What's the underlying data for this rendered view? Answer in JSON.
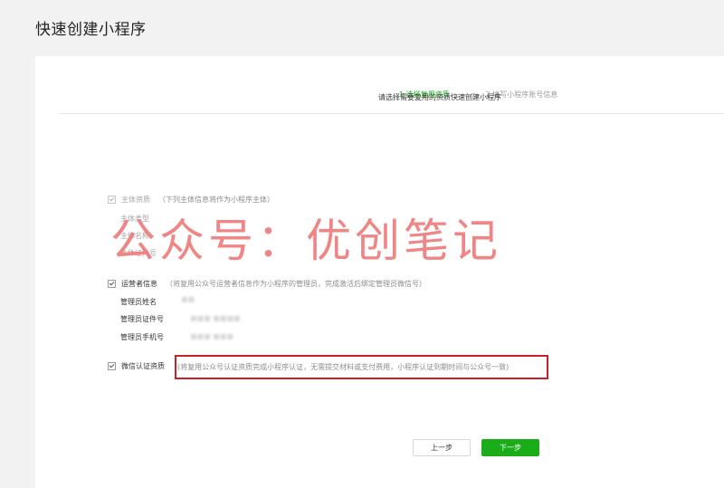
{
  "page": {
    "title": "快速创建小程序"
  },
  "steps": [
    {
      "label": "1 选择复用资质",
      "active": true
    },
    {
      "label": "2 填写小程序账号信息",
      "active": false
    }
  ],
  "intro": "请选择需要复用的资质快速创建小程序",
  "sections": {
    "entity": {
      "title": "主体资质",
      "note": "（下列主体信息将作为小程序主体）",
      "checked": true,
      "disabled": true,
      "fields": [
        "主体类型",
        "主体名称",
        "主体证件号"
      ]
    },
    "operator": {
      "title": "运营者信息",
      "note": "（将复用公众号运营者信息作为小程序的管理员，完成激活后绑定管理员微信号）",
      "checked": true,
      "disabled": false,
      "fields": [
        "管理员姓名",
        "管理员证件号",
        "管理员手机号"
      ],
      "values": [
        "■■",
        "■■■ ■■■■",
        "■■■ ■■■"
      ]
    },
    "certification": {
      "title": "微信认证资质",
      "note": "(将复用公众号认证资质完成小程序认证，无需提交材料或支付费用，小程序认证到期时间与公众号一致)",
      "checked": true,
      "disabled": false
    }
  },
  "watermark": "公众号：优创笔记",
  "buttons": {
    "prev": "上一步",
    "next": "下一步"
  },
  "colors": {
    "accent": "#1aad19",
    "highlight": "#c9212a",
    "watermark": "#f07f7f"
  }
}
